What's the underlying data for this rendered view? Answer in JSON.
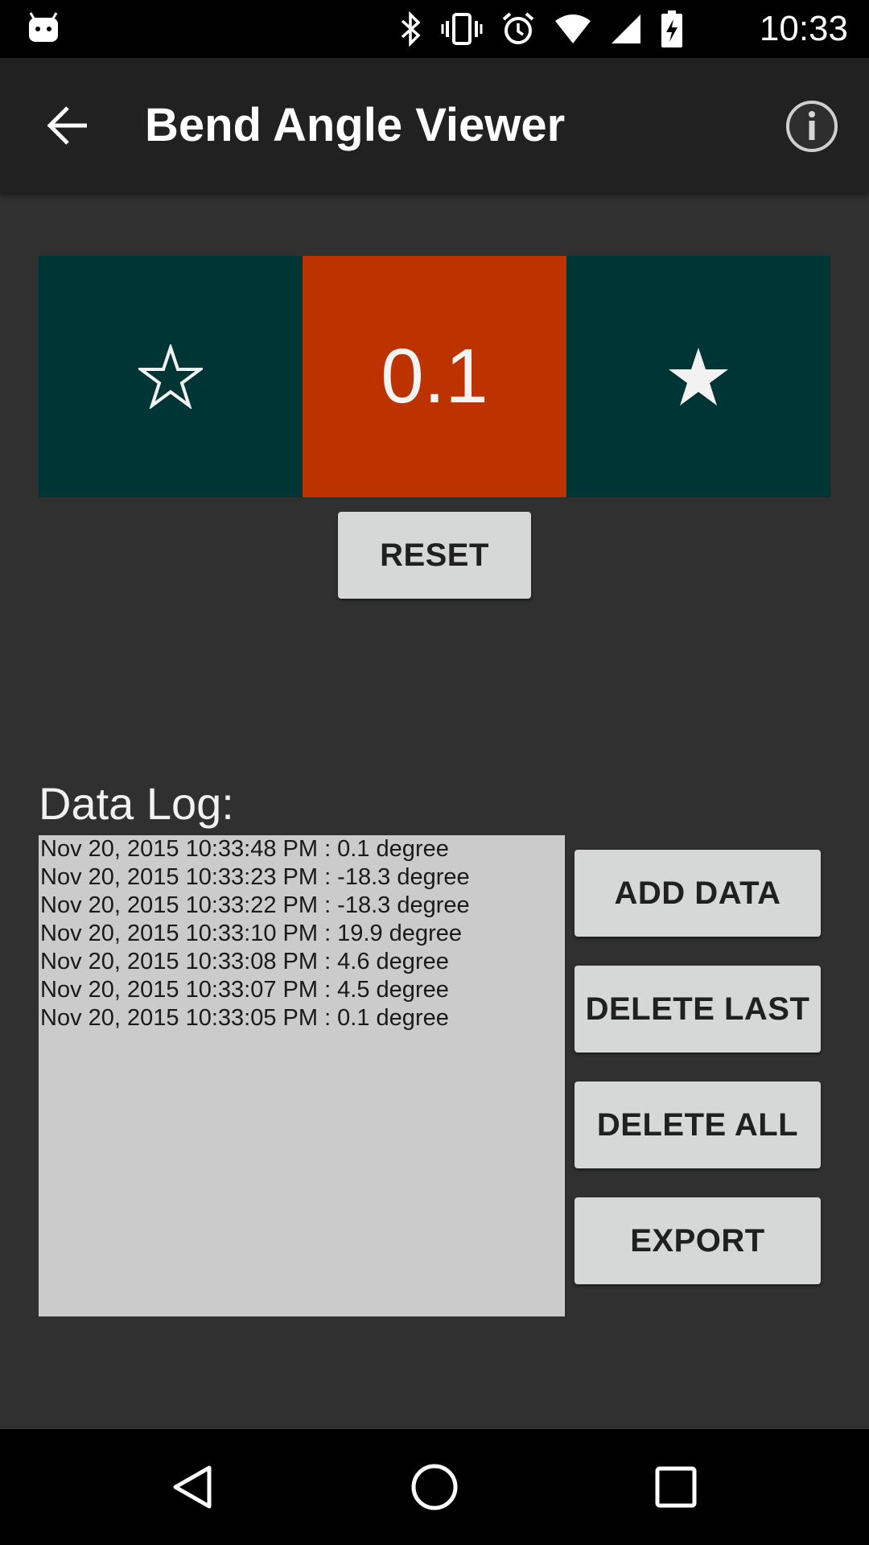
{
  "status_bar": {
    "time": "10:33",
    "icons": [
      "android-icon",
      "bluetooth-icon",
      "vibrate-icon",
      "alarm-icon",
      "wifi-icon",
      "cellular-signal-icon",
      "battery-charging-icon"
    ]
  },
  "app_bar": {
    "title": "Bend Angle Viewer",
    "back_icon": "arrow-back-icon",
    "info_icon": "info-icon"
  },
  "angle_panel": {
    "left_icon": "star-outline-icon",
    "value": "0.1",
    "right_icon": "star-filled-icon",
    "colors": {
      "side": "#003535",
      "center": "#bc3300"
    }
  },
  "reset_label": "RESET",
  "data_log": {
    "heading": "Data Log:",
    "entries": [
      "Nov 20, 2015 10:33:48 PM : 0.1 degree",
      "Nov 20, 2015 10:33:23 PM : -18.3 degree",
      "Nov 20, 2015 10:33:22 PM : -18.3 degree",
      "Nov 20, 2015 10:33:10 PM : 19.9 degree",
      "Nov 20, 2015 10:33:08 PM : 4.6 degree",
      "Nov 20, 2015 10:33:07 PM : 4.5 degree",
      "Nov 20, 2015 10:33:05 PM : 0.1 degree"
    ]
  },
  "actions": {
    "add_data": "ADD DATA",
    "delete_last": "DELETE LAST",
    "delete_all": "DELETE ALL",
    "export": "EXPORT"
  },
  "nav_bar": {
    "back": "nav-back-icon",
    "home": "nav-home-icon",
    "recents": "nav-recents-icon"
  }
}
